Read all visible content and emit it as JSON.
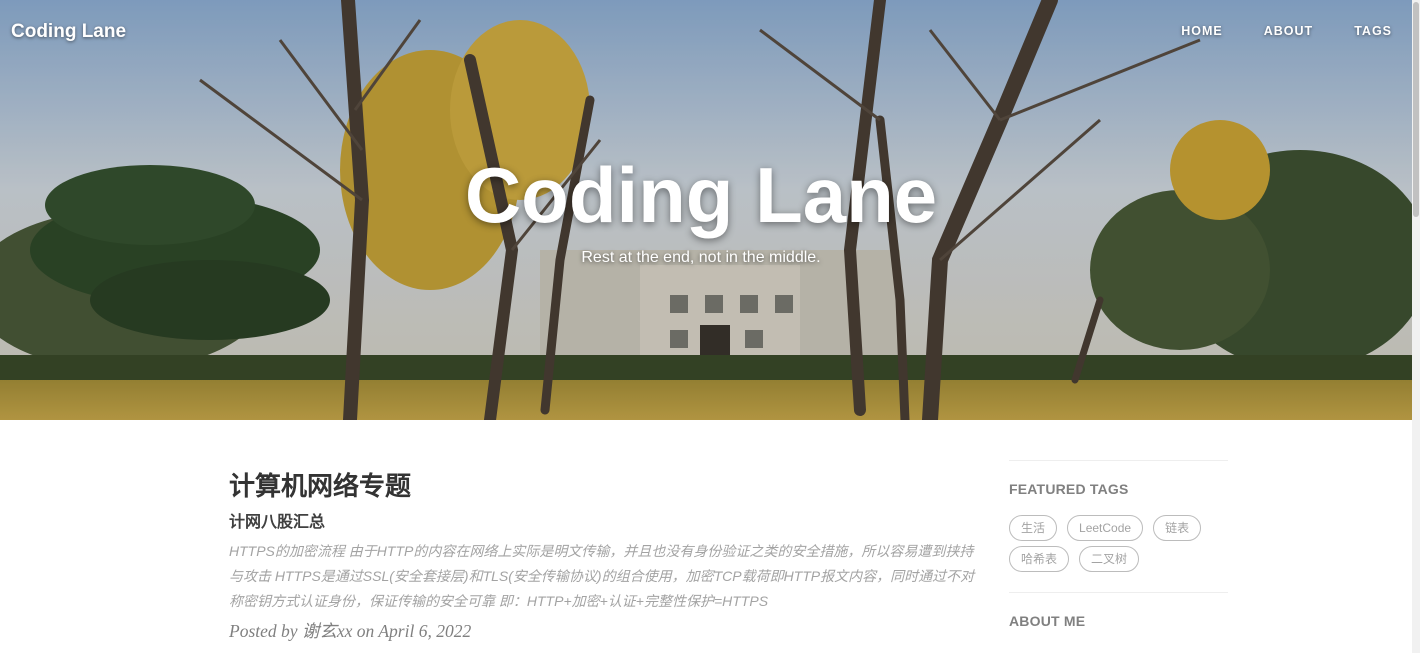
{
  "site": {
    "brand": "Coding Lane",
    "nav": [
      "HOME",
      "ABOUT",
      "TAGS"
    ],
    "hero_title": "Coding Lane",
    "hero_subtitle": "Rest at the end, not in the middle."
  },
  "post": {
    "title": "计算机网络专题",
    "subtitle": "计网八股汇总",
    "excerpt": "HTTPS的加密流程 由于HTTP的内容在网络上实际是明文传输，并且也没有身份验证之类的安全措施，所以容易遭到挟持与攻击 HTTPS是通过SSL(安全套接层)和TLS(安全传输协议)的组合使用，加密TCP载荷即HTTP报文内容，同时通过不对称密钥方式认证身份，保证传输的安全可靠 即：HTTP+加密+认证+完整性保护=HTTPS",
    "meta": "Posted by 谢玄xx on April 6, 2022"
  },
  "sidebar": {
    "featured_tags_title": "FEATURED TAGS",
    "tags": [
      "生活",
      "LeetCode",
      "链表",
      "哈希表",
      "二叉树"
    ],
    "about_title": "ABOUT ME"
  }
}
